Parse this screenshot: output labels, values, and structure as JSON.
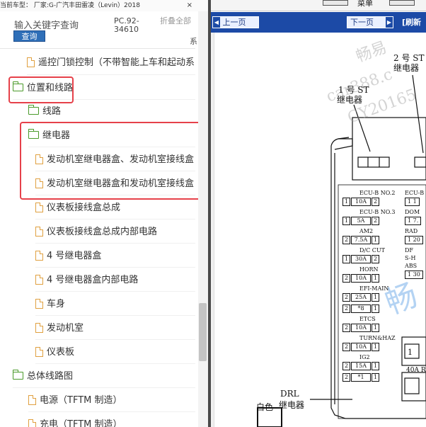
{
  "left": {
    "topbar": {
      "text": "当前车型： 厂家:G-广汽丰田雷凌（Levin）2018",
      "close": "×"
    },
    "search": {
      "label": "输入关键字查询",
      "button": "查询"
    },
    "model_code": "PC.92-34610",
    "collapse_all": "折叠全部",
    "tail_char": "系",
    "tree": [
      {
        "label": "遥控门锁控制（不带智能上车和起动系",
        "icon": "doc-icon"
      },
      {
        "label": "位置和线路",
        "icon": "folder-icon"
      },
      {
        "label": "线路",
        "icon": "folder-icon"
      },
      {
        "label": "继电器",
        "icon": "folder-icon"
      },
      {
        "label": "发动机室继电器盒、发动机室接线盒",
        "icon": "doc-icon"
      },
      {
        "label": "发动机室继电器盒和发动机室接线盒",
        "icon": "doc-icon"
      },
      {
        "label": "仪表板接线盒总成",
        "icon": "doc-icon"
      },
      {
        "label": "仪表板接线盒总成内部电路",
        "icon": "doc-icon"
      },
      {
        "label": "4 号继电器盒",
        "icon": "doc-icon"
      },
      {
        "label": "4 号继电器盒内部电路",
        "icon": "doc-icon"
      },
      {
        "label": "车身",
        "icon": "doc-icon"
      },
      {
        "label": "发动机室",
        "icon": "doc-icon"
      },
      {
        "label": "仪表板",
        "icon": "doc-icon"
      },
      {
        "label": "总体线路图",
        "icon": "folder-icon"
      },
      {
        "label": "电源（TFTM 制造）",
        "icon": "doc-icon"
      },
      {
        "label": "充电（TFTM 制造）",
        "icon": "doc-icon"
      }
    ],
    "highlight_color": "#e6414a"
  },
  "right": {
    "menu_label": "菜单",
    "nav": {
      "prev": "上一页",
      "next": "下一页",
      "refresh": "[刷新"
    },
    "watermark": {
      "w1": "畅易",
      "w2": "car388.c",
      "w3": "CY20165",
      "w4": "畅"
    },
    "diagram": {
      "relay1": "1 号 ST",
      "relay1_b": "继电器",
      "relay2": "2 号 ST",
      "relay2_b": "继电器",
      "fuses": [
        {
          "name": "ECU-B NO.2",
          "a": "1",
          "amp": "10A",
          "b": "2"
        },
        {
          "name": "ECU-B NO.3",
          "a": "1",
          "amp": "5A",
          "b": "2"
        },
        {
          "name": "AM2",
          "a": "2",
          "amp": "7.5A",
          "b": "1"
        },
        {
          "name": "D/C CUT",
          "a": "1",
          "amp": "30A",
          "b": "2"
        },
        {
          "name": "HORN",
          "a": "2",
          "amp": "10A",
          "b": "1"
        },
        {
          "name": "EFI-MAIN",
          "a": "2",
          "amp": "25A",
          "b": "1"
        },
        {
          "name": "",
          "a": "2",
          "amp": "*8",
          "b": "1"
        },
        {
          "name": "ETCS",
          "a": "2",
          "amp": "10A",
          "b": "1"
        },
        {
          "name": "TURN&HAZ",
          "a": "2",
          "amp": "10A",
          "b": "1"
        },
        {
          "name": "IG2",
          "a": "2",
          "amp": "15A",
          "b": "1"
        },
        {
          "name": "",
          "a": "2",
          "amp": "*1",
          "b": "1"
        }
      ],
      "right_col": [
        "ECU-B",
        "1 1",
        "DOM",
        "1 7.",
        "RAD",
        "1 20",
        "DF",
        "S-H",
        "ABS",
        "1 30"
      ],
      "drl": "DRL",
      "drl_b": "继电器",
      "white": "白色",
      "fortyA": "40A R",
      "one": "1"
    }
  }
}
